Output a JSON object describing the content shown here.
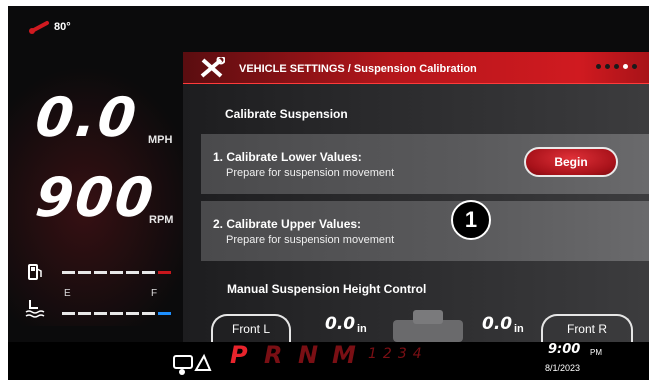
{
  "temperature": "80°",
  "speed": {
    "value": "0.0",
    "unit": "MPH"
  },
  "rpm": {
    "value": "900",
    "unit": "RPM"
  },
  "fuel": {
    "empty_label": "E",
    "full_label": "F"
  },
  "header": {
    "title": "VEHICLE SETTINGS / Suspension Calibration",
    "page_count": 5,
    "current_page": 3
  },
  "calibrate": {
    "title": "Calibrate Suspension",
    "lower": {
      "title": "1. Calibrate Lower Values:",
      "subtitle": "Prepare for suspension movement",
      "button": "Begin"
    },
    "upper": {
      "title": "2. Calibrate Upper Values:",
      "subtitle": "Prepare for suspension movement"
    }
  },
  "manual": {
    "title": "Manual Suspension Height Control",
    "front_left": {
      "label": "Front L",
      "value": "0.0",
      "unit": "in"
    },
    "front_right": {
      "label": "Front R",
      "value": "0.0",
      "unit": "in"
    }
  },
  "callout": "1",
  "gears": {
    "p": "P",
    "r": "R",
    "n": "N",
    "m": "M",
    "numbers": "1234"
  },
  "clock": {
    "time": "9:00",
    "ampm": "PM",
    "date": "8/1/2023"
  },
  "colors": {
    "accent_red": "#c8161c",
    "fuel_full": "#1e90ff",
    "inactive_gear": "#7a0f14"
  }
}
